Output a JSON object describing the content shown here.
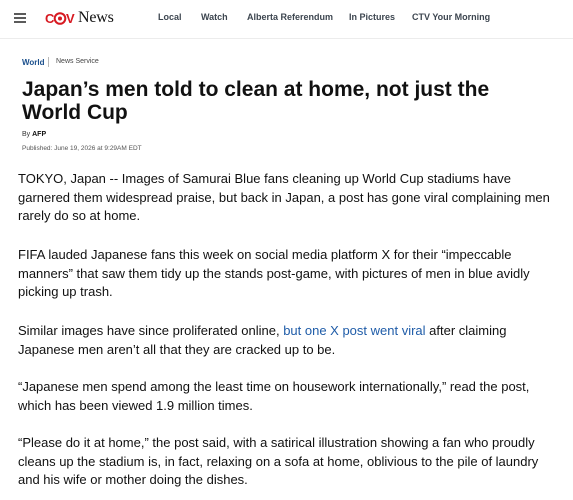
{
  "nav": {
    "logo_text": "News",
    "items": [
      "Local",
      "Watch",
      "Alberta Referendum",
      "In Pictures",
      "CTV Your Morning"
    ]
  },
  "colors": {
    "brand_red": "#d71921",
    "brand_blue": "#1a4f8c",
    "link": "#1f5ca8"
  },
  "article": {
    "section": "World",
    "source": "News Service",
    "headline": "Japan’s men told to clean at home, not just the World Cup",
    "byline_prefix": "By",
    "byline_author": "AFP",
    "published": "Published: June 19, 2026 at 9:29AM EDT",
    "paragraphs": [
      {
        "text": "TOKYO, Japan -- Images of Samurai Blue fans cleaning up World Cup stadiums have garnered them widespread praise, but back in Japan, a post has gone viral complaining men rarely do so at home."
      },
      {
        "text": "FIFA lauded Japanese fans this week on social media platform X for their “impeccable manners” that saw them tidy up the stands post-game, with pictures of men in blue avidly picking up trash."
      },
      {
        "before": "Similar images have since proliferated online, ",
        "link": "but one X post went viral",
        "after": " after claiming Japanese men aren’t all that they are cracked up to be."
      },
      {
        "text": "“Japanese men spend among the least time on housework internationally,” read the post, which has been viewed 1.9 million times."
      },
      {
        "text": "“Please do it at home,” the post said, with a satirical illustration showing a fan who proudly cleans up the stadium is, in fact, relaxing on a sofa at home, oblivious to the pile of laundry and his wife or mother doing the dishes."
      }
    ]
  }
}
